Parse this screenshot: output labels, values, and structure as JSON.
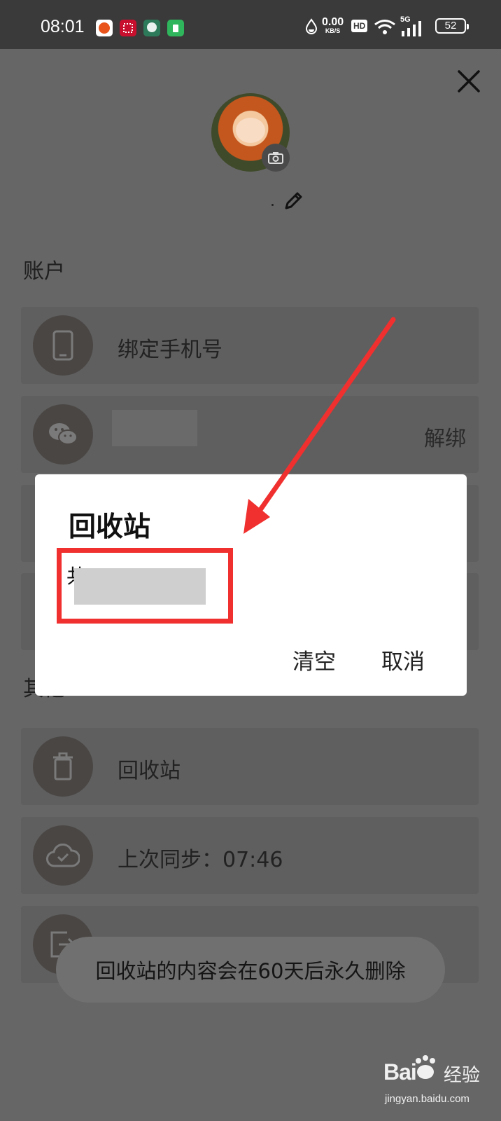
{
  "status_bar": {
    "time": "08:01",
    "net_speed_value": "0.00",
    "net_speed_unit": "KB/S",
    "hd": "HD",
    "signal_label": "5G",
    "battery": "52"
  },
  "account_section": {
    "title": "账户",
    "bind_phone_label": "绑定手机号",
    "unbind_label": "解绑"
  },
  "other_section": {
    "title": "其他",
    "recycle_bin_label": "回收站",
    "last_sync_label": "上次同步：07:46",
    "logout_label": "退出登录"
  },
  "dialog": {
    "title": "回收站",
    "message_prefix": "共",
    "clear_button": "清空",
    "cancel_button": "取消"
  },
  "toast": {
    "message": "回收站的内容会在60天后永久删除"
  },
  "watermark": {
    "brand": "Bai",
    "suffix": "经验",
    "url": "jingyan.baidu.com"
  },
  "colors": {
    "overlay": "#666666",
    "annotation_red": "#f0302e",
    "dialog_bg": "#ffffff"
  }
}
